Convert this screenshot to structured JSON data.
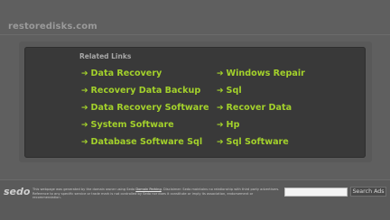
{
  "header": {
    "domain": "restoredisks.com"
  },
  "links_section": {
    "heading": "Related Links",
    "arrow": "➔",
    "left_column": [
      "Data Recovery",
      "Recovery Data Backup",
      "Data Recovery Software",
      "System Software",
      "Database Software Sql"
    ],
    "right_column": [
      "Windows Repair",
      "Sql",
      "Recover Data",
      "Hp",
      "Sql Software"
    ]
  },
  "footer": {
    "logo": "sedo",
    "disclaimer_part1": "This webpage was generated by the domain owner using Sedo ",
    "disclaimer_link": "Domain Parking",
    "disclaimer_part2": ". Disclaimer: Sedo maintains no relationship with third party advertisers. Reference to any specific service or trade mark is not controlled by Sedo nor does it constitute or imply its association, endorsement or recommendation.",
    "search_placeholder": "",
    "search_button": "Search Ads"
  },
  "colors": {
    "background": "#5f5f5f",
    "panel": "#393939",
    "link": "#a3d12b",
    "heading": "#a8a8a8"
  }
}
